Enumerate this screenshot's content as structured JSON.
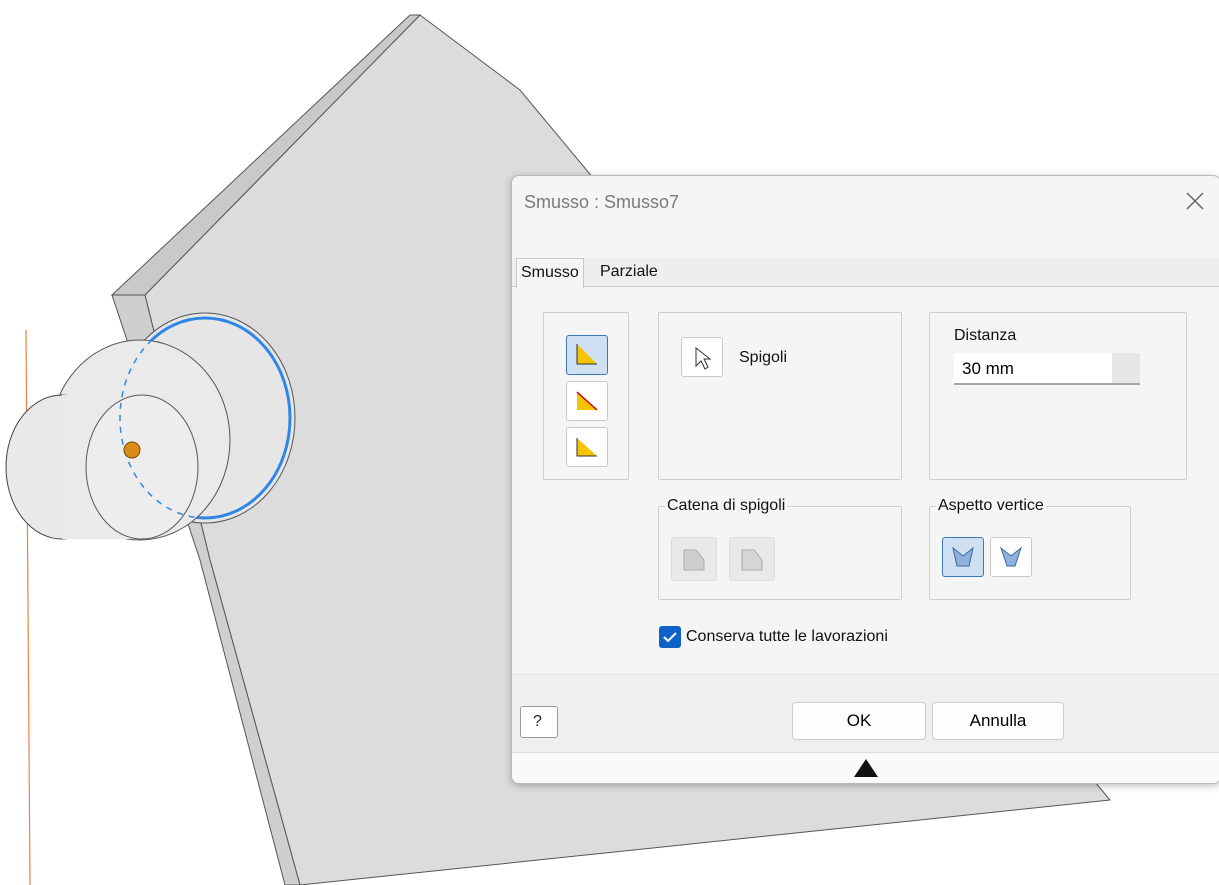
{
  "dialog": {
    "title": "Smusso : Smusso7",
    "tabs": [
      "Smusso",
      "Parziale"
    ],
    "selection_label": "Spigoli",
    "distance": {
      "label": "Distanza",
      "value": "30 mm"
    },
    "chain_group": "Catena di spigoli",
    "vertex_group": "Aspetto vertice",
    "checkbox": {
      "label": "Conserva tutte le lavorazioni",
      "checked": true
    },
    "ok": "OK",
    "cancel": "Annulla",
    "help_icon_text": "?"
  },
  "colors": {
    "accent": "#0f62c8",
    "selected": "#cfe0f2",
    "icon_yellow": "#f5c400"
  },
  "icons": [
    "close-icon",
    "method-distance-icon",
    "method-distance-angle-icon",
    "method-two-distances-icon",
    "arrow-cursor-icon",
    "chain-edges-icon",
    "chain-single-icon",
    "vertex-setback-icon",
    "vertex-blend-icon",
    "help-icon",
    "expand-arrow-icon"
  ]
}
